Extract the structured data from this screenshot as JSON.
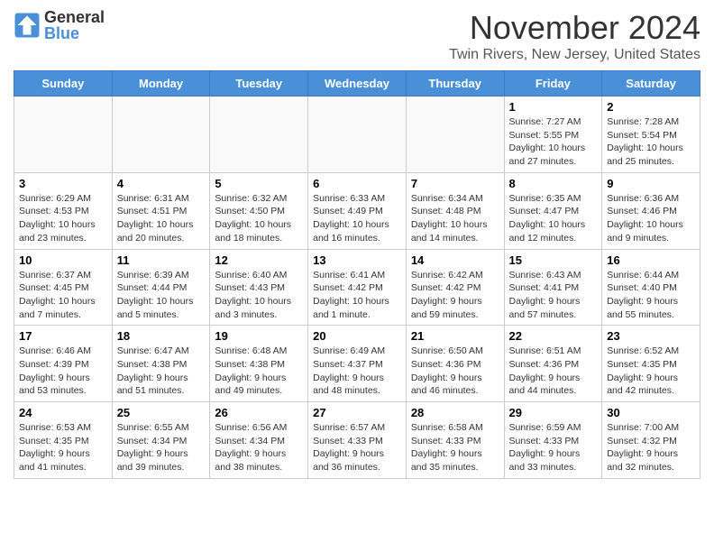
{
  "logo": {
    "general": "General",
    "blue": "Blue"
  },
  "header": {
    "month": "November 2024",
    "location": "Twin Rivers, New Jersey, United States"
  },
  "weekdays": [
    "Sunday",
    "Monday",
    "Tuesday",
    "Wednesday",
    "Thursday",
    "Friday",
    "Saturday"
  ],
  "weeks": [
    [
      {
        "day": "",
        "info": ""
      },
      {
        "day": "",
        "info": ""
      },
      {
        "day": "",
        "info": ""
      },
      {
        "day": "",
        "info": ""
      },
      {
        "day": "",
        "info": ""
      },
      {
        "day": "1",
        "info": "Sunrise: 7:27 AM\nSunset: 5:55 PM\nDaylight: 10 hours and 27 minutes."
      },
      {
        "day": "2",
        "info": "Sunrise: 7:28 AM\nSunset: 5:54 PM\nDaylight: 10 hours and 25 minutes."
      }
    ],
    [
      {
        "day": "3",
        "info": "Sunrise: 6:29 AM\nSunset: 4:53 PM\nDaylight: 10 hours and 23 minutes."
      },
      {
        "day": "4",
        "info": "Sunrise: 6:31 AM\nSunset: 4:51 PM\nDaylight: 10 hours and 20 minutes."
      },
      {
        "day": "5",
        "info": "Sunrise: 6:32 AM\nSunset: 4:50 PM\nDaylight: 10 hours and 18 minutes."
      },
      {
        "day": "6",
        "info": "Sunrise: 6:33 AM\nSunset: 4:49 PM\nDaylight: 10 hours and 16 minutes."
      },
      {
        "day": "7",
        "info": "Sunrise: 6:34 AM\nSunset: 4:48 PM\nDaylight: 10 hours and 14 minutes."
      },
      {
        "day": "8",
        "info": "Sunrise: 6:35 AM\nSunset: 4:47 PM\nDaylight: 10 hours and 12 minutes."
      },
      {
        "day": "9",
        "info": "Sunrise: 6:36 AM\nSunset: 4:46 PM\nDaylight: 10 hours and 9 minutes."
      }
    ],
    [
      {
        "day": "10",
        "info": "Sunrise: 6:37 AM\nSunset: 4:45 PM\nDaylight: 10 hours and 7 minutes."
      },
      {
        "day": "11",
        "info": "Sunrise: 6:39 AM\nSunset: 4:44 PM\nDaylight: 10 hours and 5 minutes."
      },
      {
        "day": "12",
        "info": "Sunrise: 6:40 AM\nSunset: 4:43 PM\nDaylight: 10 hours and 3 minutes."
      },
      {
        "day": "13",
        "info": "Sunrise: 6:41 AM\nSunset: 4:42 PM\nDaylight: 10 hours and 1 minute."
      },
      {
        "day": "14",
        "info": "Sunrise: 6:42 AM\nSunset: 4:42 PM\nDaylight: 9 hours and 59 minutes."
      },
      {
        "day": "15",
        "info": "Sunrise: 6:43 AM\nSunset: 4:41 PM\nDaylight: 9 hours and 57 minutes."
      },
      {
        "day": "16",
        "info": "Sunrise: 6:44 AM\nSunset: 4:40 PM\nDaylight: 9 hours and 55 minutes."
      }
    ],
    [
      {
        "day": "17",
        "info": "Sunrise: 6:46 AM\nSunset: 4:39 PM\nDaylight: 9 hours and 53 minutes."
      },
      {
        "day": "18",
        "info": "Sunrise: 6:47 AM\nSunset: 4:38 PM\nDaylight: 9 hours and 51 minutes."
      },
      {
        "day": "19",
        "info": "Sunrise: 6:48 AM\nSunset: 4:38 PM\nDaylight: 9 hours and 49 minutes."
      },
      {
        "day": "20",
        "info": "Sunrise: 6:49 AM\nSunset: 4:37 PM\nDaylight: 9 hours and 48 minutes."
      },
      {
        "day": "21",
        "info": "Sunrise: 6:50 AM\nSunset: 4:36 PM\nDaylight: 9 hours and 46 minutes."
      },
      {
        "day": "22",
        "info": "Sunrise: 6:51 AM\nSunset: 4:36 PM\nDaylight: 9 hours and 44 minutes."
      },
      {
        "day": "23",
        "info": "Sunrise: 6:52 AM\nSunset: 4:35 PM\nDaylight: 9 hours and 42 minutes."
      }
    ],
    [
      {
        "day": "24",
        "info": "Sunrise: 6:53 AM\nSunset: 4:35 PM\nDaylight: 9 hours and 41 minutes."
      },
      {
        "day": "25",
        "info": "Sunrise: 6:55 AM\nSunset: 4:34 PM\nDaylight: 9 hours and 39 minutes."
      },
      {
        "day": "26",
        "info": "Sunrise: 6:56 AM\nSunset: 4:34 PM\nDaylight: 9 hours and 38 minutes."
      },
      {
        "day": "27",
        "info": "Sunrise: 6:57 AM\nSunset: 4:33 PM\nDaylight: 9 hours and 36 minutes."
      },
      {
        "day": "28",
        "info": "Sunrise: 6:58 AM\nSunset: 4:33 PM\nDaylight: 9 hours and 35 minutes."
      },
      {
        "day": "29",
        "info": "Sunrise: 6:59 AM\nSunset: 4:33 PM\nDaylight: 9 hours and 33 minutes."
      },
      {
        "day": "30",
        "info": "Sunrise: 7:00 AM\nSunset: 4:32 PM\nDaylight: 9 hours and 32 minutes."
      }
    ]
  ]
}
